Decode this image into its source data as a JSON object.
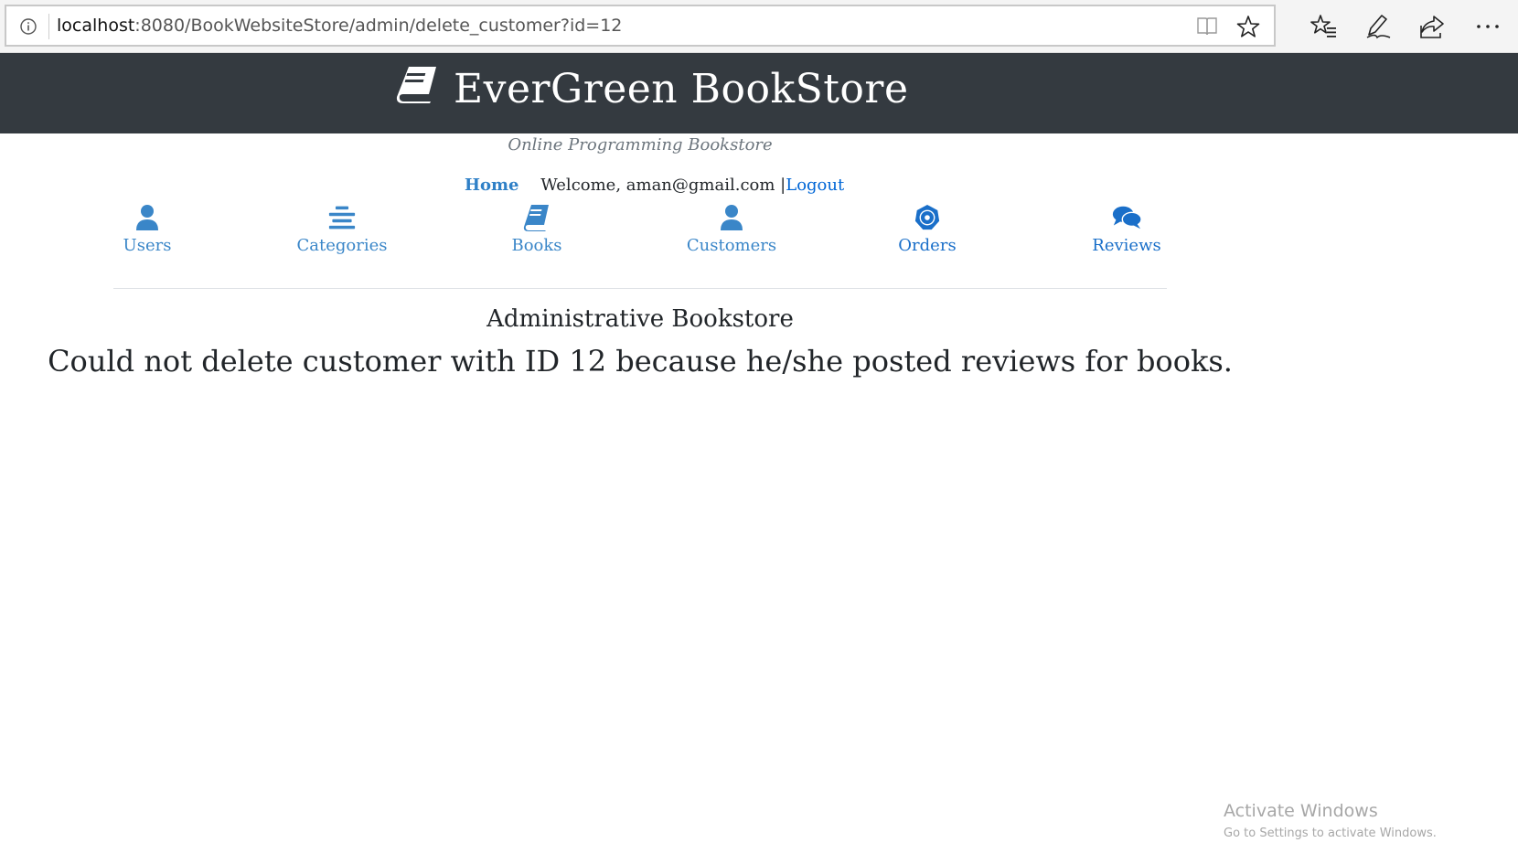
{
  "browser": {
    "url_host": "localhost",
    "url_rest": ":8080/BookWebsiteStore/admin/delete_customer?id=12",
    "icons": [
      "info-icon",
      "reading-view-icon",
      "favorite-star-icon",
      "favorites-hub-icon",
      "pen-notes-icon",
      "share-icon",
      "more-options-icon"
    ]
  },
  "header": {
    "title": "EverGreen BookStore",
    "tagline": "Online Programming Bookstore",
    "background": "#343a40"
  },
  "top_links": {
    "home": "Home",
    "welcome": "Welcome, aman@gmail.com |",
    "logout": "Logout"
  },
  "admin_nav": [
    {
      "label": "Users",
      "icon": "user-icon"
    },
    {
      "label": "Categories",
      "icon": "categories-icon"
    },
    {
      "label": "Books",
      "icon": "book-icon"
    },
    {
      "label": "Customers",
      "icon": "customer-icon"
    },
    {
      "label": "Orders",
      "icon": "orders-icon"
    },
    {
      "label": "Reviews",
      "icon": "comments-icon"
    }
  ],
  "main": {
    "heading": "Administrative Bookstore",
    "message": "Could not delete customer with ID 12 because he/she posted reviews for books."
  },
  "watermark": {
    "title": "Activate Windows",
    "subtitle": "Go to Settings to activate Windows."
  },
  "colors": {
    "nav_link": "#3a86c8",
    "logout_link": "#0066d6"
  }
}
